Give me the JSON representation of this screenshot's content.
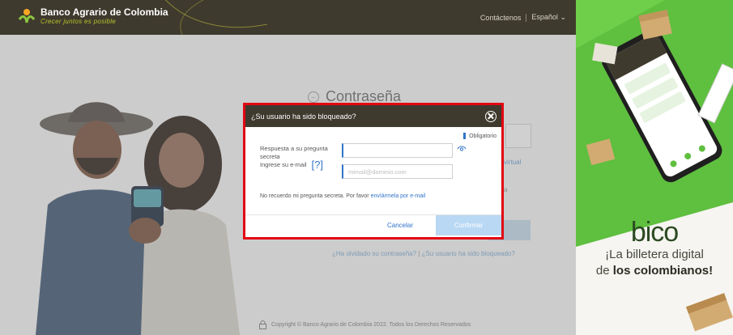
{
  "header": {
    "brand_name": "Banco Agrario de Colombia",
    "slogan": "Crecer juntos es posible",
    "contact_label": "Contáctenos",
    "language_label": "Español",
    "background_color": "#3f3a2e",
    "slogan_color": "#b7c62a"
  },
  "page": {
    "title": "Contraseña",
    "virtual_fragment": "virtual",
    "a_fragment": "a",
    "forgot_password_link": "¿Ha olvidado su contraseña?",
    "link_separator": "|",
    "blocked_user_link": "¿Su usuario ha sido bloqueado?",
    "footer_copyright": "Copyright © Banco Agrario de Colombia 2022. Todos los Derechos Reservados"
  },
  "modal": {
    "title": "¿Su usuario ha sido bloqueado?",
    "required_label": "Obligatorio",
    "answer_label": "Respuesta a su pregunta secreta",
    "answer_value": "",
    "email_label": "Ingrese su e-mail",
    "email_help_icon": "[?]",
    "email_placeholder": "mimail@dominio.com",
    "forgot_text": "No recuerdo mi pregunta secreta. Por favor",
    "forgot_link": "envíármela por e-mail",
    "cancel_label": "Cancelar",
    "confirm_label": "Confirmar",
    "border_color": "#e30613",
    "accent_color": "#2f73c8"
  },
  "ad": {
    "brand": "bico",
    "line1": "¡La billetera digital",
    "line2_prefix": "de",
    "line2_bold": "los colombianos!"
  },
  "icons": {
    "close": "close-icon",
    "back": "back-arrow-icon",
    "eye": "eye-icon",
    "lock": "lock-icon",
    "chevron": "chevron-down-icon"
  }
}
